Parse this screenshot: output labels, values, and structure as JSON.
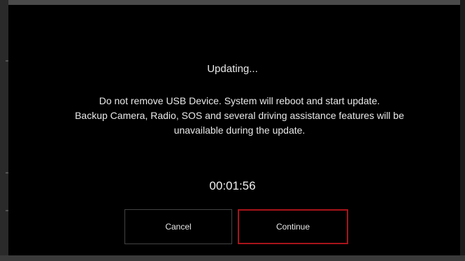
{
  "dialog": {
    "title": "Updating...",
    "message_lines": [
      "Do not remove USB Device. System will reboot and start update.",
      "Backup Camera, Radio, SOS and several driving assistance features will be",
      "unavailable during the update."
    ],
    "timer": "00:01:56",
    "buttons": {
      "cancel": "Cancel",
      "continue": "Continue"
    }
  },
  "colors": {
    "background": "#000000",
    "text": "#e9e9e9",
    "continue_border": "#a8141a",
    "cancel_border": "#444444"
  }
}
